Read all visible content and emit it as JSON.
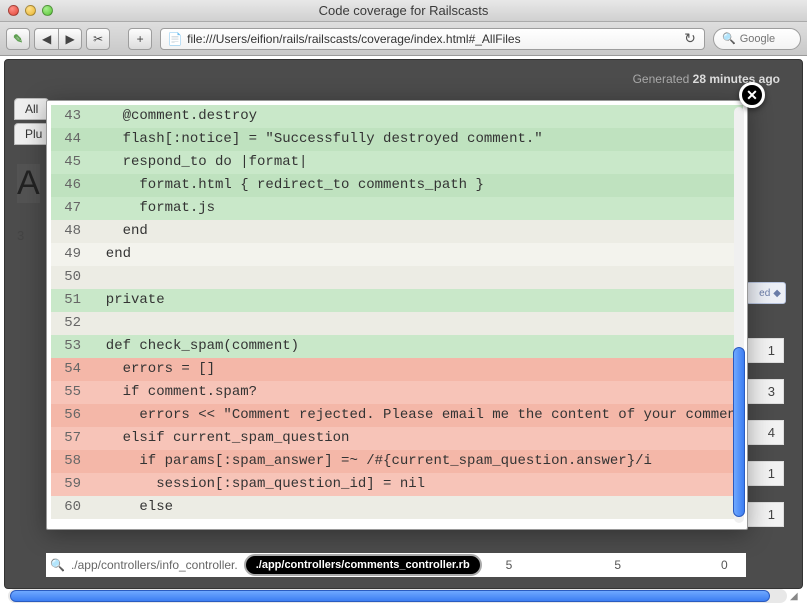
{
  "window": {
    "title": "Code coverage for Railscasts"
  },
  "toolbar": {
    "back": "◀",
    "forward": "▶",
    "menu_icon": "✂",
    "add": "+",
    "url_scheme_icon": "📄",
    "url": "file:///Users/eifion/rails/railscasts/coverage/index.html#_AllFiles",
    "reload": "↻",
    "search_placeholder": "Google",
    "search_value": ""
  },
  "page": {
    "generated_prefix": "Generated ",
    "generated_value": "28 minutes ago",
    "bg_tab_all": "All",
    "bg_tab_plu": "Plu",
    "bg_letter": "A",
    "bg_count": "3",
    "bg_sort_label": "ed",
    "bg_sort_arrow": "◆",
    "bg_right_values": [
      "1",
      "3",
      "4",
      "1",
      "1"
    ]
  },
  "modal": {
    "close": "✕",
    "lines": [
      {
        "n": 43,
        "cov": "hit",
        "text": "    @comment.destroy"
      },
      {
        "n": 44,
        "cov": "hit-alt",
        "text": "    flash[:notice] = \"Successfully destroyed comment.\""
      },
      {
        "n": 45,
        "cov": "hit",
        "text": "    respond_to do |format|"
      },
      {
        "n": 46,
        "cov": "hit-alt",
        "text": "      format.html { redirect_to comments_path }"
      },
      {
        "n": 47,
        "cov": "hit",
        "text": "      format.js"
      },
      {
        "n": 48,
        "cov": "none-alt",
        "text": "    end"
      },
      {
        "n": 49,
        "cov": "none",
        "text": "  end"
      },
      {
        "n": 50,
        "cov": "none-alt",
        "text": ""
      },
      {
        "n": 51,
        "cov": "hit",
        "text": "  private"
      },
      {
        "n": 52,
        "cov": "none-alt",
        "text": ""
      },
      {
        "n": 53,
        "cov": "hit",
        "text": "  def check_spam(comment)"
      },
      {
        "n": 54,
        "cov": "miss-alt",
        "text": "    errors = []"
      },
      {
        "n": 55,
        "cov": "miss",
        "text": "    if comment.spam?"
      },
      {
        "n": 56,
        "cov": "miss-alt",
        "text": "      errors << \"Comment rejected. Please email me the content of your comment fo"
      },
      {
        "n": 57,
        "cov": "miss",
        "text": "    elsif current_spam_question"
      },
      {
        "n": 58,
        "cov": "miss-alt",
        "text": "      if params[:spam_answer] =~ /#{current_spam_question.answer}/i"
      },
      {
        "n": 59,
        "cov": "miss",
        "text": "        session[:spam_question_id] = nil"
      },
      {
        "n": 60,
        "cov": "none-alt",
        "text": "      else"
      }
    ]
  },
  "breadcrumb": {
    "search_icon": "🔍",
    "path_before": "./app/controllers/info_controller.",
    "pill": "./app/controllers/comments_controller.rb",
    "col1": "5",
    "col2": "5",
    "col3": "0"
  }
}
